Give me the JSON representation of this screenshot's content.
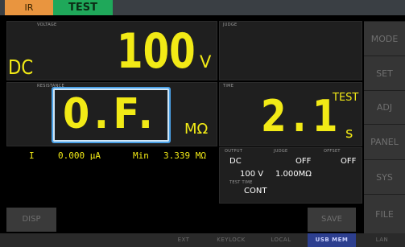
{
  "status_bar": {
    "mode_ir": "IR",
    "mode_test": "TEST"
  },
  "voltage_panel": {
    "label": "VOLTAGE",
    "prefix": "DC",
    "value": "100",
    "unit": "V"
  },
  "judge_panel": {
    "label": "JUDGE"
  },
  "resistance_panel": {
    "label": "RESISTANCE",
    "value": "0.F.",
    "unit": "MΩ"
  },
  "time_panel": {
    "label": "TIME",
    "value": "2.1",
    "unit": "s",
    "state": "TEST"
  },
  "current_row": {
    "label": "I",
    "current": "0.000 μA",
    "min_label": "Min",
    "min_value": "3.339 MΩ"
  },
  "settings_panel": {
    "output_label": "OUTPUT",
    "output_value": "DC",
    "voltage_value": "100 V",
    "judge_label": "JUDGE",
    "judge_value": "OFF",
    "judge_limit": "1.000MΩ",
    "offset_label": "OFFSET",
    "offset_value": "OFF",
    "test_time_label": "TEST TIME",
    "test_time_value": "CONT"
  },
  "side_menu": [
    "MODE",
    "SET",
    "ADJ",
    "PANEL",
    "SYS",
    "FILE"
  ],
  "buttons": {
    "disp": "DISP",
    "save": "SAVE"
  },
  "bottom_status": {
    "ext": "EXT",
    "keylock": "KEYLOCK",
    "local": "LOCAL",
    "usb_mem": "USB MEM",
    "lan": "LAN"
  },
  "colors": {
    "measurement": "#f2ea16",
    "highlight_frame": "#4aa0e6",
    "test_badge": "#1fa85a",
    "ir_badge": "#e9953f"
  }
}
